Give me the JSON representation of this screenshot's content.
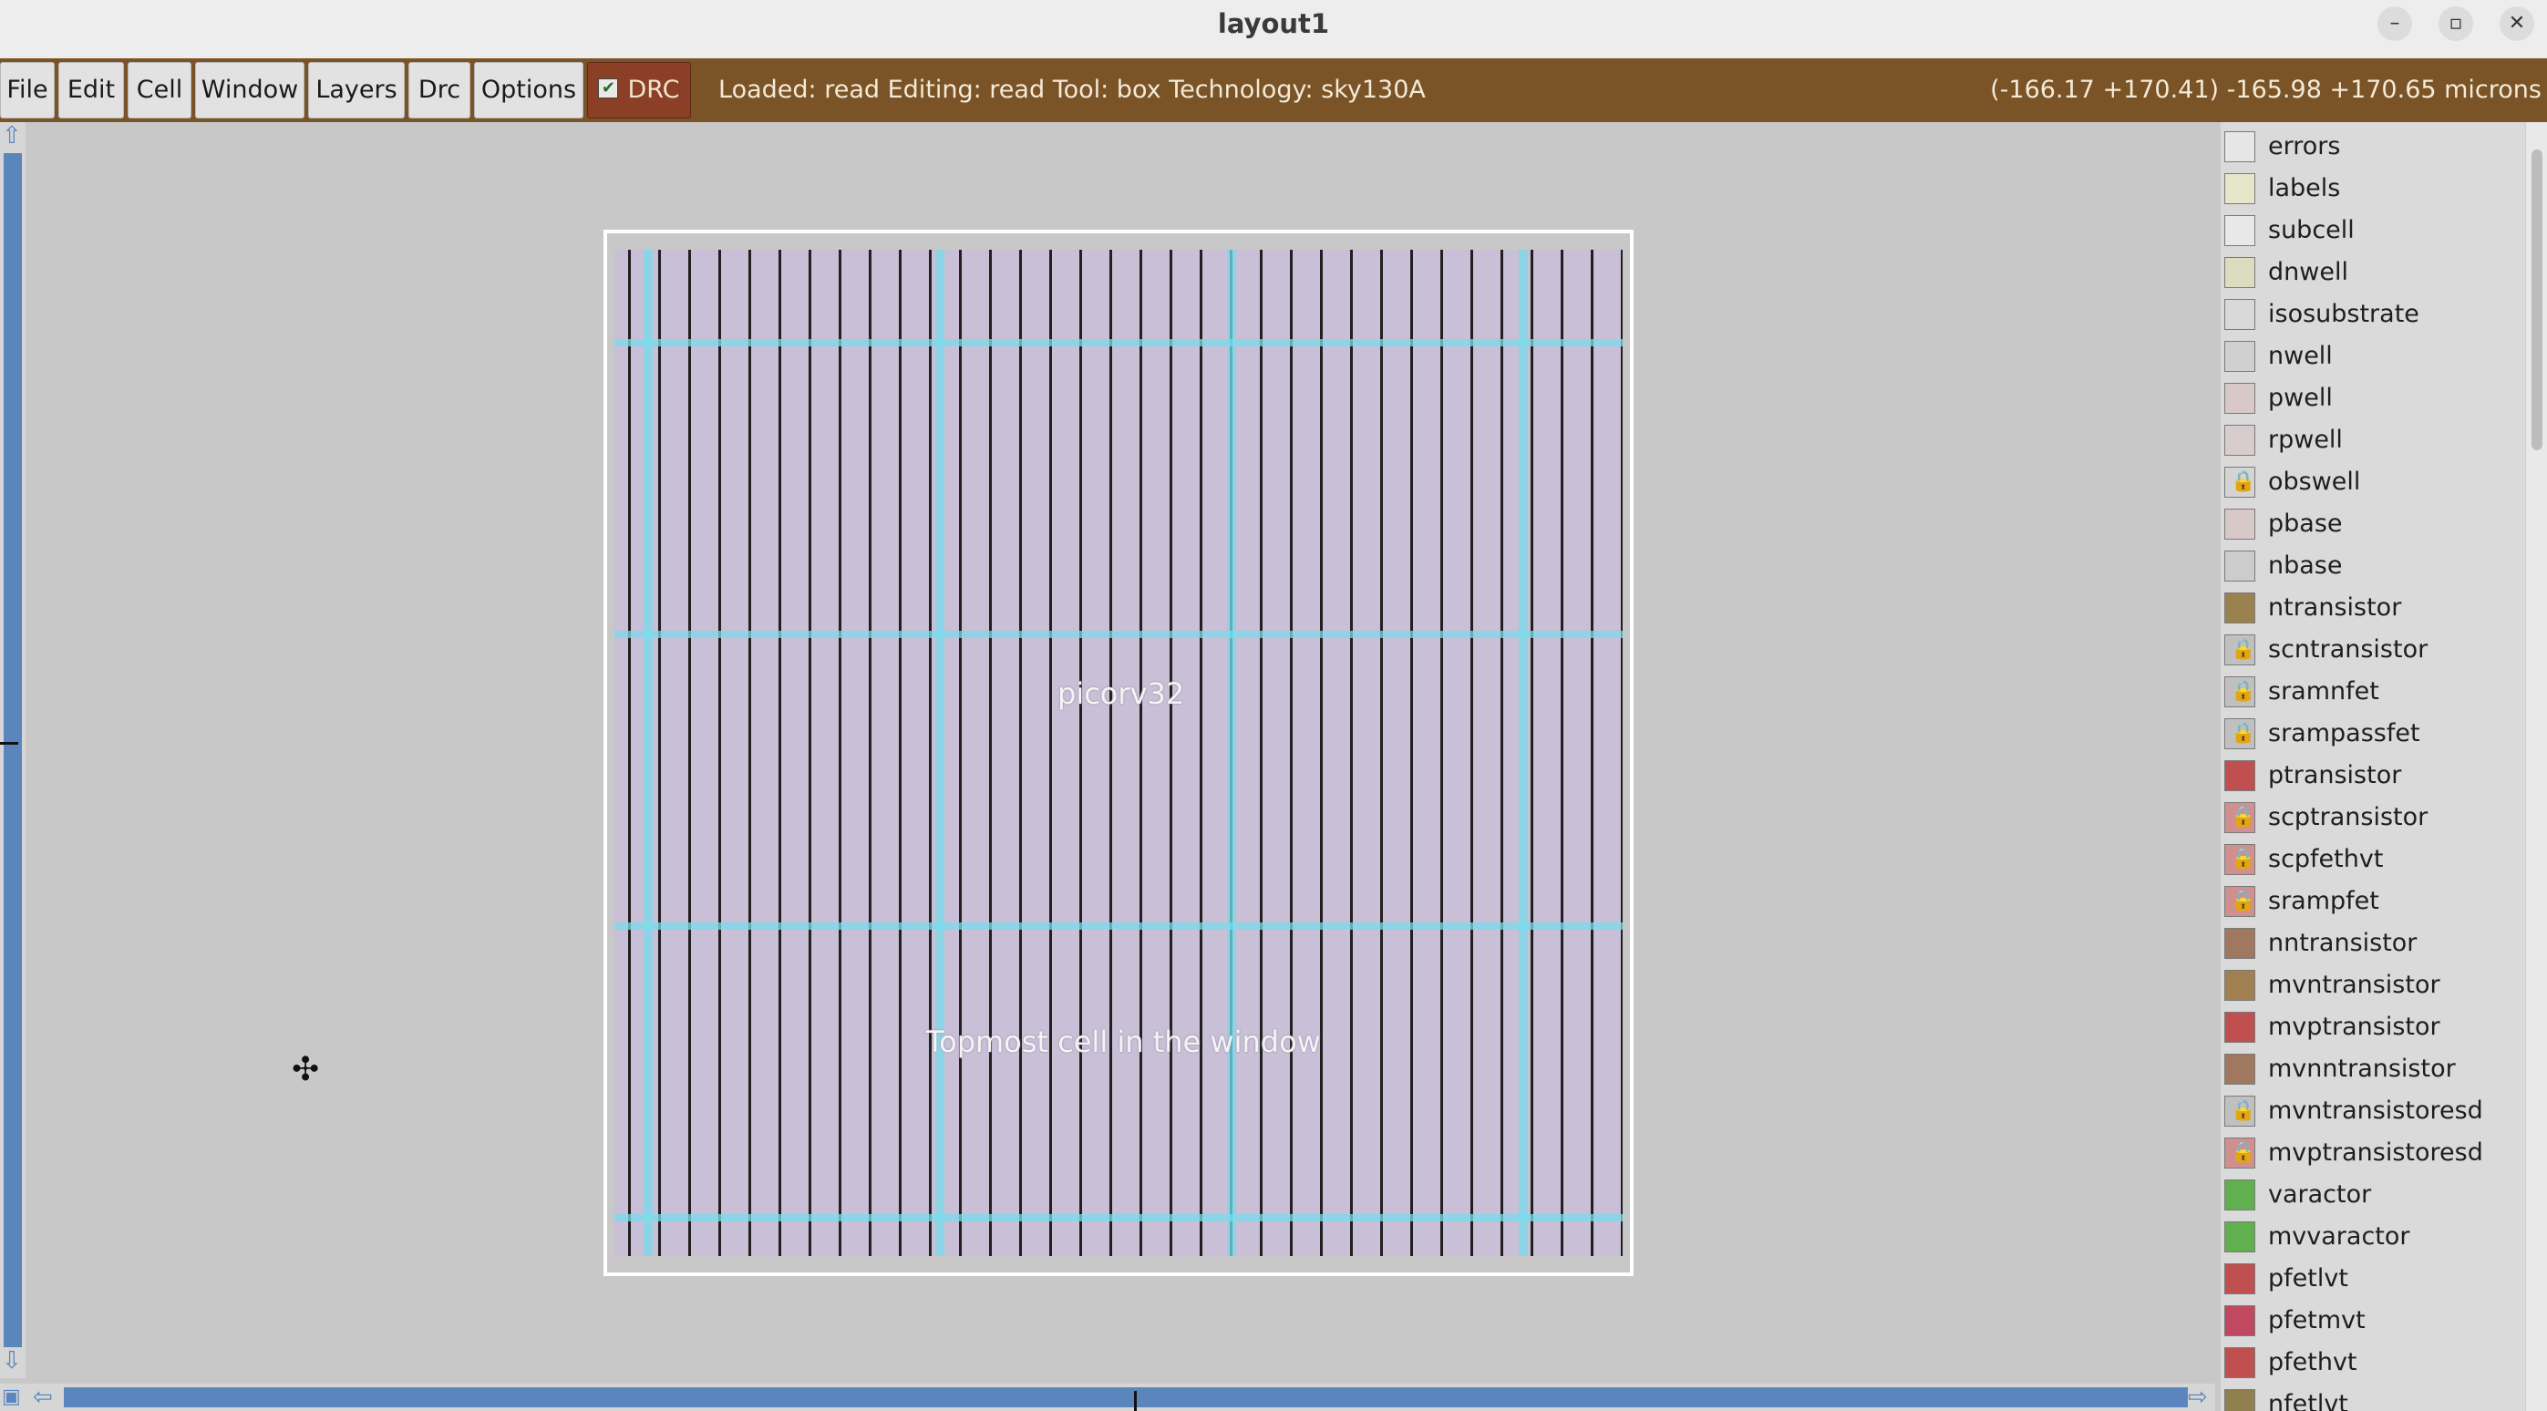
{
  "window": {
    "title": "layout1",
    "minimize_icon": "minimize-icon",
    "maximize_icon": "maximize-icon",
    "close_icon": "close-icon"
  },
  "menu": {
    "file": "File",
    "edit": "Edit",
    "cell": "Cell",
    "window": "Window",
    "layers": "Layers",
    "drc": "Drc",
    "options": "Options",
    "drc_toggle": "DRC",
    "drc_checked": true
  },
  "status": {
    "info": "Loaded: read Editing: read Tool: box  Technology: sky130A",
    "coordinates": "(-166.17 +170.41) -165.98 +170.65 microns"
  },
  "canvas": {
    "cell_name": "picorv32",
    "cell_caption": "Topmost cell in the window"
  },
  "layers": [
    {
      "name": "errors",
      "color": "#e6e6e6",
      "locked": false
    },
    {
      "name": "labels",
      "color": "#e6e6c8",
      "locked": false
    },
    {
      "name": "subcell",
      "color": "#e8e8e8",
      "locked": false
    },
    {
      "name": "dnwell",
      "color": "#dcdcc0",
      "locked": false
    },
    {
      "name": "isosubstrate",
      "color": "#d8d8d8",
      "locked": false
    },
    {
      "name": "nwell",
      "color": "#d0d0d0",
      "locked": false
    },
    {
      "name": "pwell",
      "color": "#d8c8c8",
      "locked": false
    },
    {
      "name": "rpwell",
      "color": "#d8cccc",
      "locked": false
    },
    {
      "name": "obswell",
      "color": "#d4d4d4",
      "locked": true
    },
    {
      "name": "pbase",
      "color": "#d8c8c8",
      "locked": false
    },
    {
      "name": "nbase",
      "color": "#cccccc",
      "locked": false
    },
    {
      "name": "ntransistor",
      "color": "#9a8250",
      "locked": false
    },
    {
      "name": "scntransistor",
      "color": "#c0c0c0",
      "locked": true
    },
    {
      "name": "sramnfet",
      "color": "#c0c0c0",
      "locked": true
    },
    {
      "name": "srampassfet",
      "color": "#c0c0c0",
      "locked": true
    },
    {
      "name": "ptransistor",
      "color": "#c05050",
      "locked": false
    },
    {
      "name": "scptransistor",
      "color": "#d09090",
      "locked": true
    },
    {
      "name": "scpfethvt",
      "color": "#d09090",
      "locked": true
    },
    {
      "name": "srampfet",
      "color": "#d09090",
      "locked": true
    },
    {
      "name": "nntransistor",
      "color": "#a07860",
      "locked": false
    },
    {
      "name": "mvntransistor",
      "color": "#a08050",
      "locked": false
    },
    {
      "name": "mvptransistor",
      "color": "#c05050",
      "locked": false
    },
    {
      "name": "mvnntransistor",
      "color": "#a07860",
      "locked": false
    },
    {
      "name": "mvntransistoresd",
      "color": "#c0c0c0",
      "locked": true
    },
    {
      "name": "mvptransistoresd",
      "color": "#d09090",
      "locked": true
    },
    {
      "name": "varactor",
      "color": "#60b050",
      "locked": false
    },
    {
      "name": "mvvaractor",
      "color": "#60b050",
      "locked": false
    },
    {
      "name": "pfetlvt",
      "color": "#c05050",
      "locked": false
    },
    {
      "name": "pfetmvt",
      "color": "#c04860",
      "locked": false
    },
    {
      "name": "pfethvt",
      "color": "#c05050",
      "locked": false
    },
    {
      "name": "nfetlvt",
      "color": "#908050",
      "locked": false
    }
  ]
}
